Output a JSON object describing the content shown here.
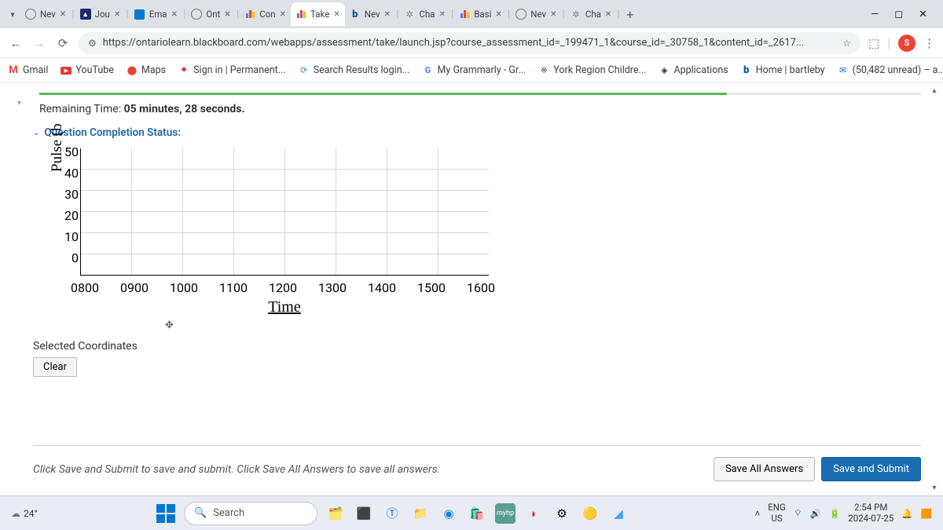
{
  "tabs": [
    {
      "title": "Nev",
      "favicon": "chrome-circle"
    },
    {
      "title": "Jou",
      "favicon": "blue-tri"
    },
    {
      "title": "Ema",
      "favicon": "outlook"
    },
    {
      "title": "Ont",
      "favicon": "chrome-circle"
    },
    {
      "title": "Con",
      "favicon": "bars"
    },
    {
      "title": "Take",
      "favicon": "bars",
      "active": true
    },
    {
      "title": "Nev",
      "favicon": "b-logo"
    },
    {
      "title": "Cha",
      "favicon": "flower"
    },
    {
      "title": "Basi",
      "favicon": "bars"
    },
    {
      "title": "Nev",
      "favicon": "chrome-circle"
    },
    {
      "title": "Cha",
      "favicon": "flower"
    }
  ],
  "url": "https://ontariolearn.blackboard.com/webapps/assessment/take/launch.jsp?course_assessment_id=_199471_1&course_id=_30758_1&content_id=_2617...",
  "avatar_letter": "S",
  "bookmarks": [
    {
      "icon": "gmail",
      "label": "Gmail"
    },
    {
      "icon": "youtube",
      "label": "YouTube"
    },
    {
      "icon": "maps",
      "label": "Maps"
    },
    {
      "icon": "leaf",
      "label": "Sign in | Permanent..."
    },
    {
      "icon": "dloop",
      "label": "Search Results login..."
    },
    {
      "icon": "google",
      "label": "My Grammarly - Gr..."
    },
    {
      "icon": "york",
      "label": "York Region Childre..."
    },
    {
      "icon": "diamond",
      "label": "Applications"
    },
    {
      "icon": "b-logo",
      "label": "Home | bartleby"
    },
    {
      "icon": "mail",
      "label": "(50,482 unread) – a..."
    }
  ],
  "timer": {
    "prefix": "Remaining Time:",
    "value": "05 minutes, 28 seconds."
  },
  "completion_label": "Question Completion Status:",
  "chart_data": {
    "type": "scatter",
    "title": "",
    "xlabel": "Time",
    "ylabel": "Pulse (b",
    "x_ticks": [
      "0800",
      "0900",
      "1000",
      "1100",
      "1200",
      "1300",
      "1400",
      "1500",
      "1600"
    ],
    "y_ticks": [
      0,
      10,
      20,
      30,
      40,
      50
    ],
    "xlim": [
      "0800",
      "1600"
    ],
    "ylim": [
      0,
      50
    ],
    "values": []
  },
  "selected_label": "Selected Coordinates",
  "clear_label": "Clear",
  "footer_text": "Click Save and Submit to save and submit. Click Save All Answers to save all answers.",
  "save_all_label": "Save All Answers",
  "submit_label": "Save and Submit",
  "taskbar": {
    "weather": "24°",
    "search_placeholder": "Search",
    "lang_top": "ENG",
    "lang_bot": "US",
    "time": "2:54 PM",
    "date": "2024-07-25"
  }
}
